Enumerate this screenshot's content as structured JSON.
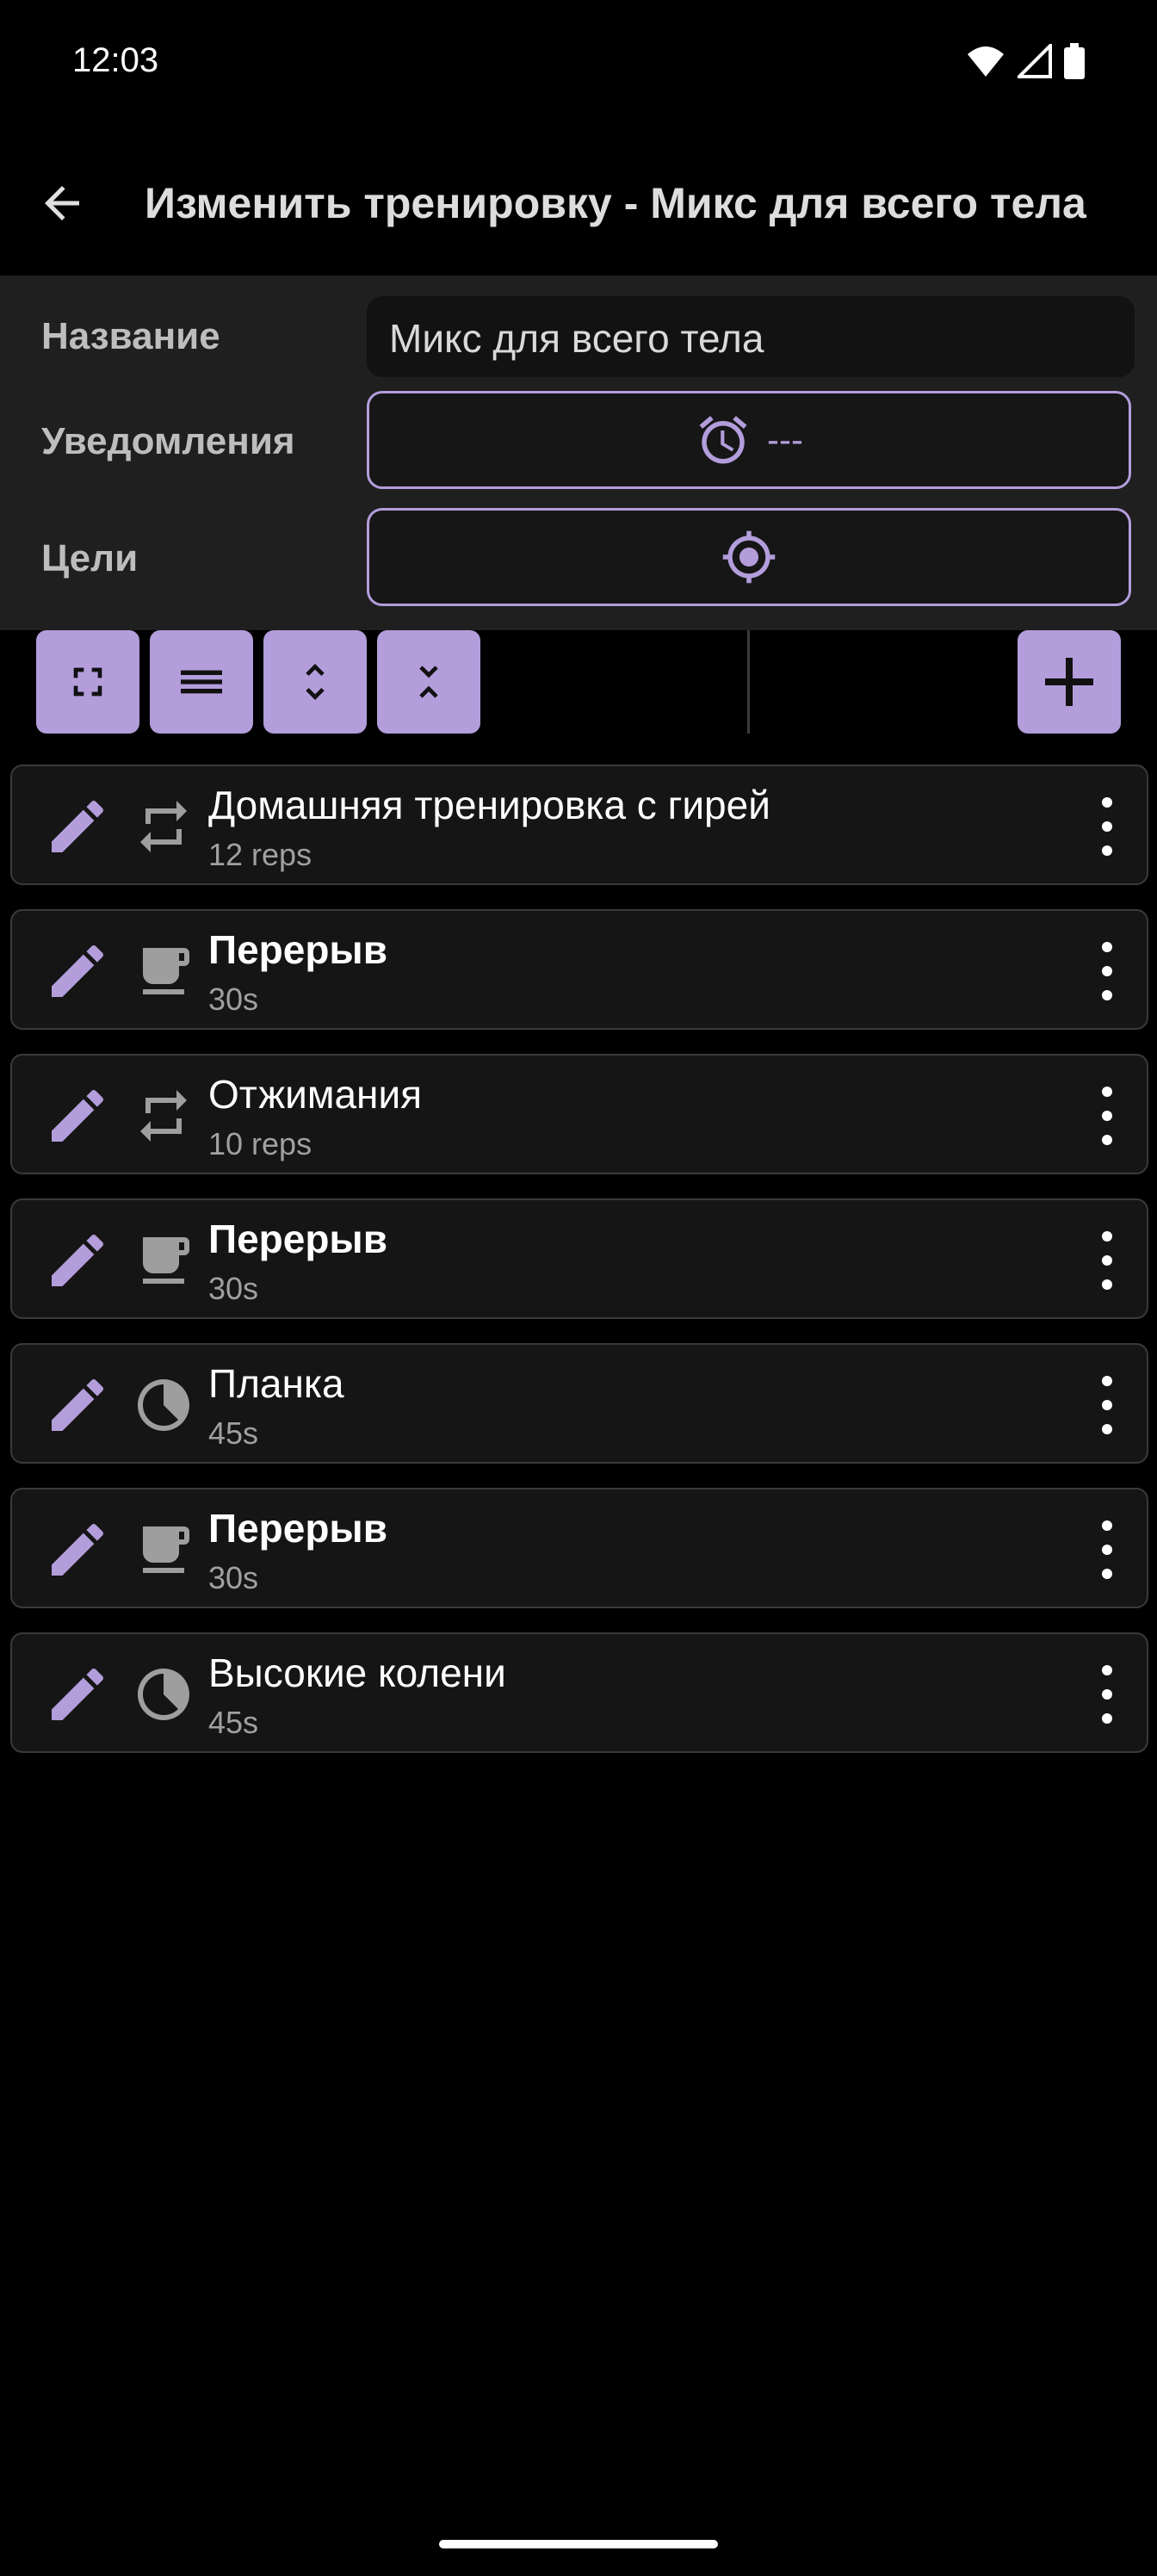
{
  "status_bar": {
    "time": "12:03",
    "icons": [
      "wifi-icon",
      "cell-signal-icon",
      "battery-icon"
    ]
  },
  "app_bar": {
    "back_icon": "arrow-back-icon",
    "title": "Изменить тренировку - Микс для всего тела"
  },
  "settings": {
    "name_label": "Название",
    "name_value": "Микс для всего тела",
    "notifications_label": "Уведомления",
    "notifications_value": "---",
    "goals_label": "Цели"
  },
  "toolbar": {
    "buttons": [
      "fullscreen-icon",
      "menu-lines-icon",
      "expand-icon",
      "collapse-icon"
    ],
    "add_button_icon": "add-icon"
  },
  "exercises": [
    {
      "name": "Домашняя тренировка с гирей",
      "meta": "12 reps",
      "kind": "repeat",
      "bold": false
    },
    {
      "name": "Перерыв",
      "meta": "30s",
      "kind": "break",
      "bold": true
    },
    {
      "name": "Отжимания",
      "meta": "10 reps",
      "kind": "repeat",
      "bold": false
    },
    {
      "name": "Перерыв",
      "meta": "30s",
      "kind": "break",
      "bold": true
    },
    {
      "name": "Планка",
      "meta": "45s",
      "kind": "timer",
      "bold": false
    },
    {
      "name": "Перерыв",
      "meta": "30s",
      "kind": "break",
      "bold": true
    },
    {
      "name": "Высокие колени",
      "meta": "45s",
      "kind": "timer",
      "bold": false
    }
  ],
  "colors": {
    "accent": "#b39ddb",
    "background": "#000000",
    "panel": "#1f1f1f",
    "card": "#151515",
    "card_border": "#3a3a3a",
    "muted_icon": "#9e9e9e"
  }
}
